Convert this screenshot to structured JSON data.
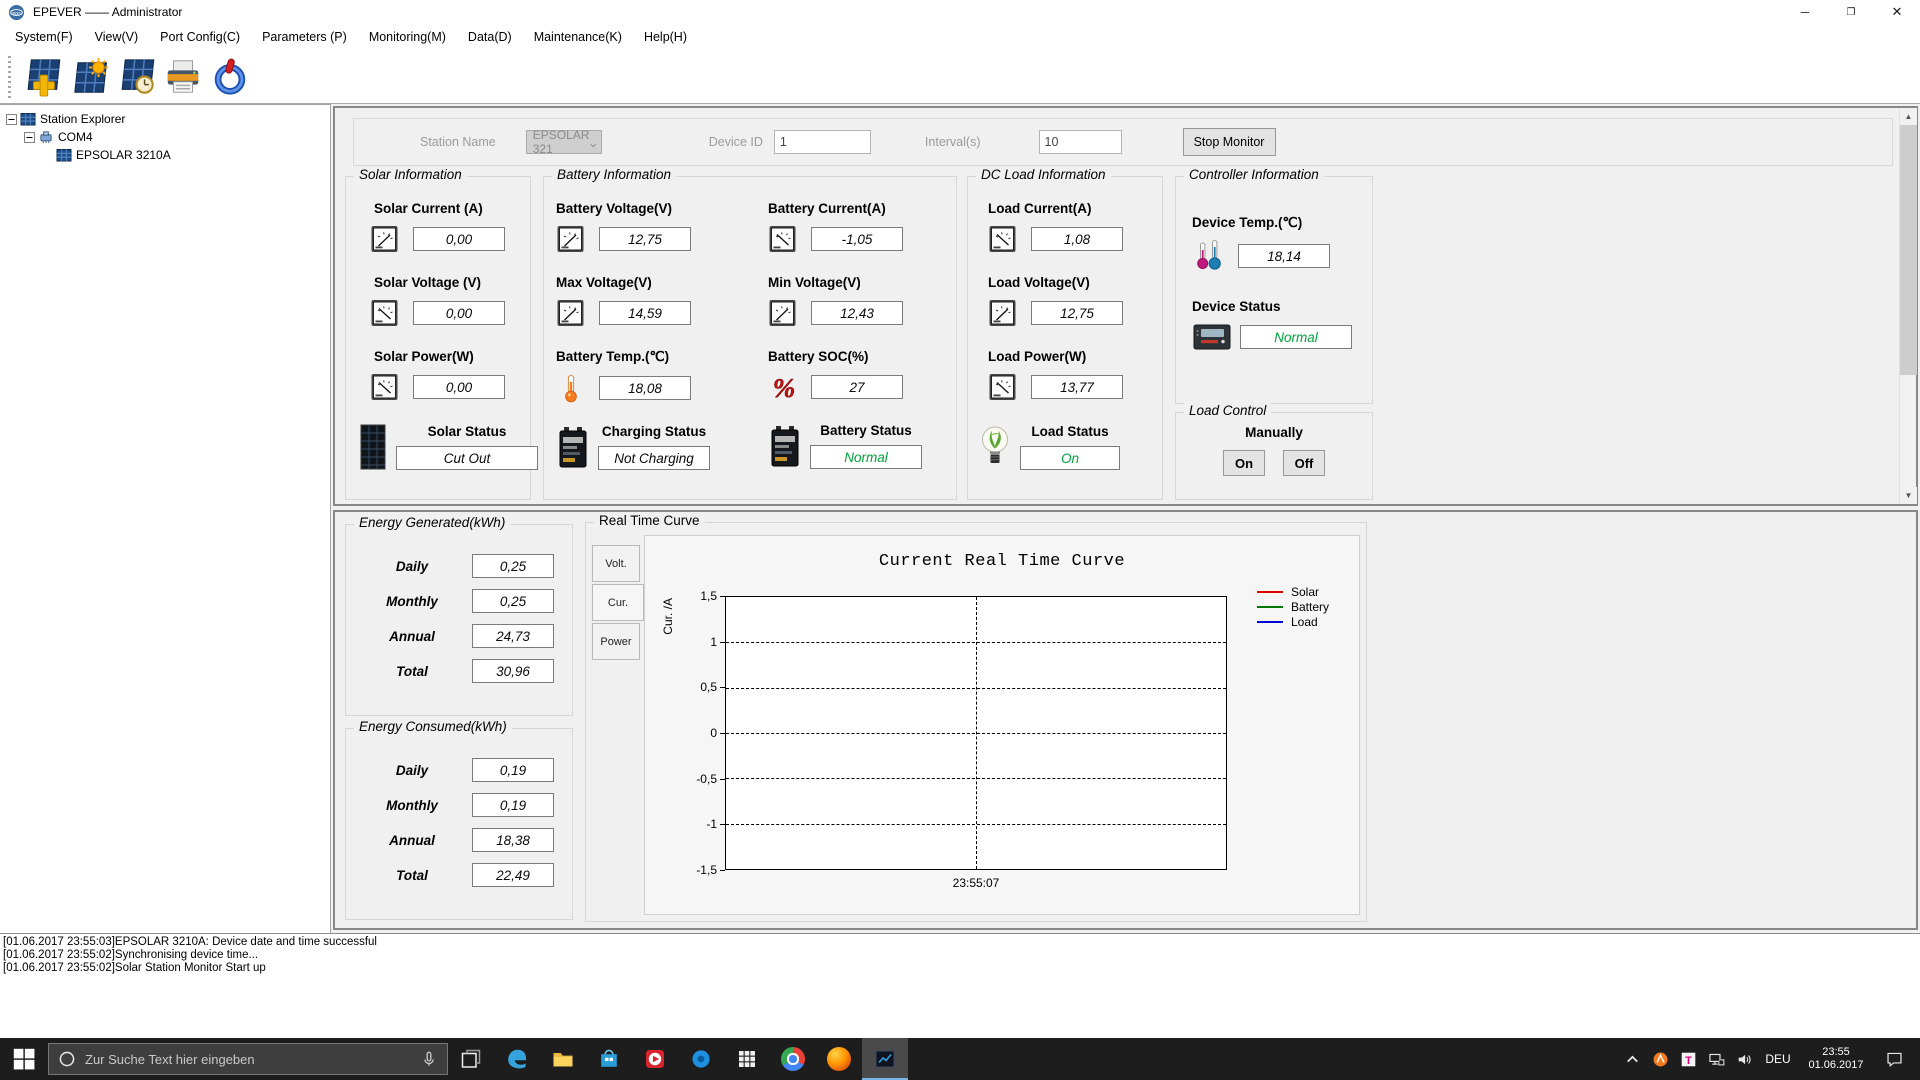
{
  "window": {
    "title": "EPEVER —— Administrator"
  },
  "menu": {
    "items": [
      "System(F)",
      "View(V)",
      "Port Config(C)",
      "Parameters (P)",
      "Monitoring(M)",
      "Data(D)",
      "Maintenance(K)",
      "Help(H)"
    ]
  },
  "tree": {
    "root": "Station Explorer",
    "port": "COM4",
    "device": "EPSOLAR 3210A"
  },
  "station_bar": {
    "station_name_label": "Station Name",
    "station_name_value": "EPSOLAR 321",
    "device_id_label": "Device ID",
    "device_id_value": "1",
    "interval_label": "Interval(s)",
    "interval_value": "10",
    "stop_monitor": "Stop Monitor"
  },
  "solar": {
    "title": "Solar Information",
    "current_label": "Solar Current (A)",
    "current_value": "0,00",
    "voltage_label": "Solar Voltage (V)",
    "voltage_value": "0,00",
    "power_label": "Solar Power(W)",
    "power_value": "0,00",
    "status_label": "Solar Status",
    "status_value": "Cut Out"
  },
  "battery": {
    "title": "Battery Information",
    "voltage_label": "Battery Voltage(V)",
    "voltage_value": "12,75",
    "current_label": "Battery Current(A)",
    "current_value": "-1,05",
    "max_voltage_label": "Max Voltage(V)",
    "max_voltage_value": "14,59",
    "min_voltage_label": "Min Voltage(V)",
    "min_voltage_value": "12,43",
    "temp_label": "Battery Temp.(℃)",
    "temp_value": "18,08",
    "soc_label": "Battery SOC(%)",
    "soc_value": "27",
    "charging_status_label": "Charging Status",
    "charging_status_value": "Not Charging",
    "battery_status_label": "Battery Status",
    "battery_status_value": "Normal"
  },
  "dc_load": {
    "title": "DC Load Information",
    "current_label": "Load Current(A)",
    "current_value": "1,08",
    "voltage_label": "Load Voltage(V)",
    "voltage_value": "12,75",
    "power_label": "Load Power(W)",
    "power_value": "13,77",
    "status_label": "Load Status",
    "status_value": "On"
  },
  "controller": {
    "title": "Controller Information",
    "temp_label": "Device Temp.(℃)",
    "temp_value": "18,14",
    "status_label": "Device Status",
    "status_value": "Normal"
  },
  "load_control": {
    "title": "Load Control",
    "manually_label": "Manually",
    "on_button": "On",
    "off_button": "Off"
  },
  "energy_generated": {
    "title": "Energy Generated(kWh)",
    "rows": [
      {
        "label": "Daily",
        "value": "0,25"
      },
      {
        "label": "Monthly",
        "value": "0,25"
      },
      {
        "label": "Annual",
        "value": "24,73"
      },
      {
        "label": "Total",
        "value": "30,96"
      }
    ]
  },
  "energy_consumed": {
    "title": "Energy Consumed(kWh)",
    "rows": [
      {
        "label": "Daily",
        "value": "0,19"
      },
      {
        "label": "Monthly",
        "value": "0,19"
      },
      {
        "label": "Annual",
        "value": "18,38"
      },
      {
        "label": "Total",
        "value": "22,49"
      }
    ]
  },
  "curve_panel": {
    "title": "Real Time Curve",
    "tabs": [
      "Volt.",
      "Cur.",
      "Power"
    ],
    "active_tab": "Cur."
  },
  "chart_data": {
    "type": "line",
    "title": "Current Real Time Curve",
    "ylabel": "Cur. /A",
    "ylim": [
      -1.5,
      1.5
    ],
    "yticks": [
      "1,5",
      "1",
      "0,5",
      "0",
      "-0,5",
      "-1",
      "-1,5"
    ],
    "xticks": [
      "23:55:07"
    ],
    "grid": true,
    "legend_position": "right",
    "series": [
      {
        "name": "Solar",
        "color": "#e00000",
        "values": []
      },
      {
        "name": "Battery",
        "color": "#007800",
        "values": []
      },
      {
        "name": "Load",
        "color": "#0000d8",
        "values": []
      }
    ]
  },
  "log": {
    "lines": [
      "[01.06.2017 23:55:03]EPSOLAR 3210A: Device date and time successful",
      "[01.06.2017 23:55:02]Synchronising device time...",
      "[01.06.2017 23:55:02]Solar Station Monitor Start up"
    ]
  },
  "taskbar": {
    "search_placeholder": "Zur Suche Text hier eingeben",
    "language": "DEU",
    "time": "23:55",
    "date": "01.06.2017"
  },
  "colors": {
    "status_green": "#00a33c",
    "solar_series": "#e00000",
    "battery_series": "#007800",
    "load_series": "#0000d8",
    "taskbar": "#1d1d1d"
  },
  "icon_names": [
    "app-logo",
    "add-station",
    "station-sun",
    "station-clock",
    "printer",
    "power",
    "station-explorer",
    "com-port",
    "device-panel",
    "gauge",
    "thermometer",
    "percent",
    "dual-thermometer",
    "controller-box",
    "solar-panel",
    "battery",
    "light-bulb",
    "dropdown-arrow",
    "scroll-up-arrow",
    "scroll-down-arrow",
    "start",
    "cortana-circle",
    "microphone",
    "task-view",
    "edge",
    "folder",
    "store",
    "media-player",
    "cortana",
    "app-grid",
    "chrome",
    "firefox",
    "epever-app",
    "tray-chevron",
    "avast",
    "telekom",
    "network",
    "speaker",
    "notification",
    "minimize",
    "maximize",
    "close"
  ]
}
